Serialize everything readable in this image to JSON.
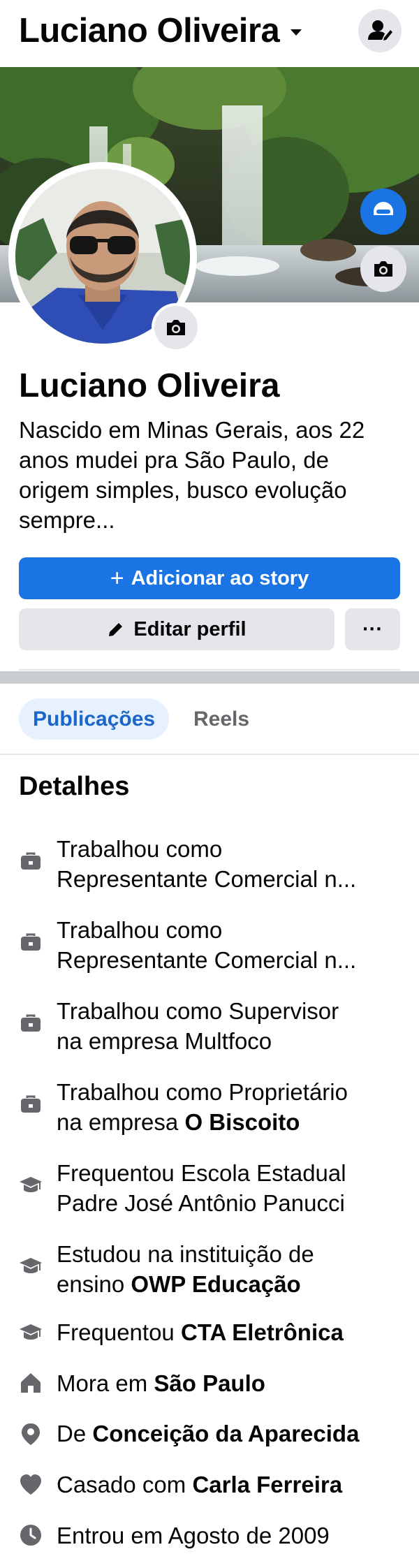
{
  "header": {
    "title": "Luciano Oliveira"
  },
  "profile": {
    "name": "Luciano Oliveira",
    "bio": "Nascido em Minas Gerais, aos 22\nanos mudei pra São Paulo, de\norigem simples, busco evolução\nsempre..."
  },
  "actions": {
    "story_label": "Adicionar ao story",
    "edit_label": "Editar perfil",
    "more_label": "···"
  },
  "tabs": [
    {
      "label": "Publicações",
      "active": true
    },
    {
      "label": "Reels",
      "active": false
    }
  ],
  "details": {
    "title": "Detalhes",
    "items": [
      {
        "icon": "briefcase-icon",
        "line1": "Trabalhou como",
        "line2": "Representante Comercial n..."
      },
      {
        "icon": "briefcase-icon",
        "line1": "Trabalhou como",
        "line2": "Representante Comercial n..."
      },
      {
        "icon": "briefcase-icon",
        "line1": "Trabalhou como Supervisor",
        "line2": "na empresa Multfoco"
      },
      {
        "icon": "briefcase-icon",
        "line1": "Trabalhou como Proprietário",
        "line2_prefix": "na empresa ",
        "line2_bold": "O Biscoito"
      },
      {
        "icon": "graduation-cap-icon",
        "line1": "Frequentou Escola Estadual",
        "line2": "Padre José Antônio Panucci"
      },
      {
        "icon": "graduation-cap-icon",
        "line1": "Estudou na instituição de",
        "line2_prefix": "ensino ",
        "line2_bold": "OWP Educação"
      },
      {
        "icon": "graduation-cap-icon",
        "prefix": "Frequentou ",
        "bold": "CTA Eletrônica"
      },
      {
        "icon": "home-icon",
        "prefix": "Mora em ",
        "bold": "São Paulo"
      },
      {
        "icon": "location-pin-icon",
        "prefix": "De ",
        "bold": "Conceição da Aparecida"
      },
      {
        "icon": "heart-icon",
        "prefix": "Casado com ",
        "bold": "Carla Ferreira"
      },
      {
        "icon": "clock-icon",
        "prefix": "Entrou em Agosto de 2009"
      }
    ]
  },
  "colors": {
    "accent": "#1b74e4",
    "tab_active_bg": "#e7f0fd",
    "button_gray": "#e4e6eb",
    "icon_gray": "#65676b"
  }
}
